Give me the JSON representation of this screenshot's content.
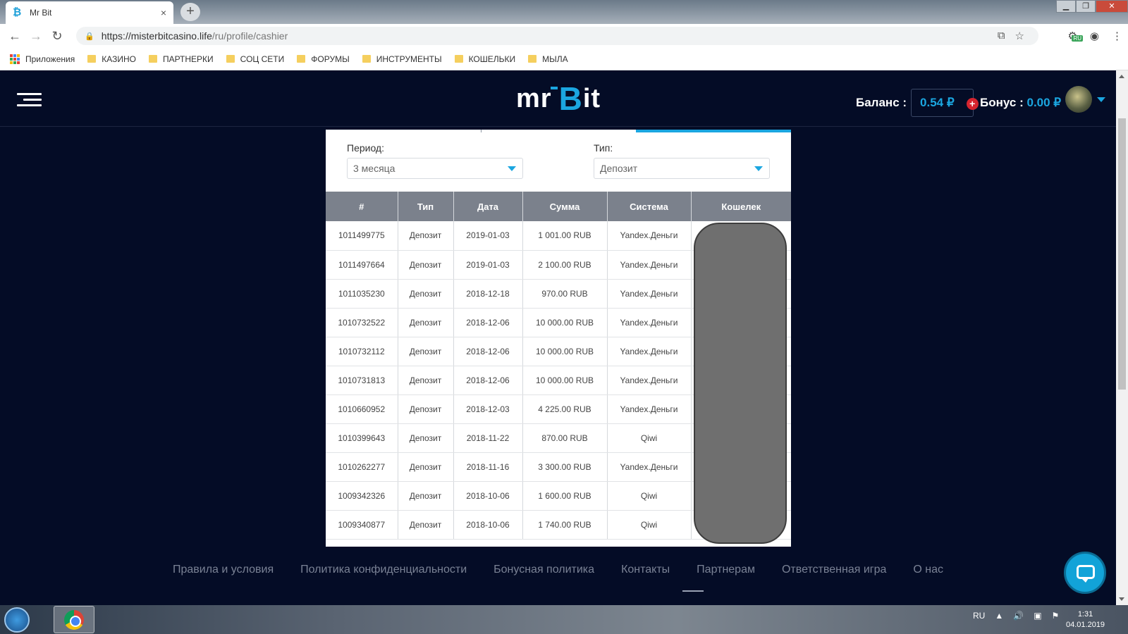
{
  "browser": {
    "tab_title": "Mr Bit",
    "tab_close": "×",
    "new_tab": "+",
    "url_host": "https://misterbitcasino.life",
    "url_path": "/ru/profile/cashier",
    "bookmarks": [
      {
        "label": "Приложения",
        "type": "apps"
      },
      {
        "label": "КАЗИНО"
      },
      {
        "label": "ПАРТНЕРКИ"
      },
      {
        "label": "СОЦ СЕТИ"
      },
      {
        "label": "ФОРУМЫ"
      },
      {
        "label": "ИНСТРУМЕНТЫ"
      },
      {
        "label": "КОШЕЛЬКИ"
      },
      {
        "label": "МЫЛА"
      }
    ],
    "extension_badge": "RU"
  },
  "site": {
    "balance_label": "Баланс :",
    "balance_value": "0.54 ₽",
    "balance_add": "+",
    "bonus_label": "Бонус :",
    "bonus_value": "0.00 ₽",
    "logo_mr": "mr",
    "logo_b": "B",
    "logo_it": "it"
  },
  "filters": {
    "period_label": "Период:",
    "period_value": "3 месяца",
    "type_label": "Тип:",
    "type_value": "Депозит"
  },
  "table": {
    "headers": [
      "#",
      "Тип",
      "Дата",
      "Сумма",
      "Система",
      "Кошелек"
    ],
    "rows": [
      [
        "1011499775",
        "Депозит",
        "2019-01-03",
        "1 001.00 RUB",
        "Yandex.Деньги"
      ],
      [
        "1011497664",
        "Депозит",
        "2019-01-03",
        "2 100.00 RUB",
        "Yandex.Деньги"
      ],
      [
        "1011035230",
        "Депозит",
        "2018-12-18",
        "970.00 RUB",
        "Yandex.Деньги"
      ],
      [
        "1010732522",
        "Депозит",
        "2018-12-06",
        "10 000.00 RUB",
        "Yandex.Деньги"
      ],
      [
        "1010732112",
        "Депозит",
        "2018-12-06",
        "10 000.00 RUB",
        "Yandex.Деньги"
      ],
      [
        "1010731813",
        "Депозит",
        "2018-12-06",
        "10 000.00 RUB",
        "Yandex.Деньги"
      ],
      [
        "1010660952",
        "Депозит",
        "2018-12-03",
        "4 225.00 RUB",
        "Yandex.Деньги"
      ],
      [
        "1010399643",
        "Депозит",
        "2018-11-22",
        "870.00 RUB",
        "Qiwi"
      ],
      [
        "1010262277",
        "Депозит",
        "2018-11-16",
        "3 300.00 RUB",
        "Yandex.Деньги"
      ],
      [
        "1009342326",
        "Депозит",
        "2018-10-06",
        "1 600.00 RUB",
        "Qiwi"
      ],
      [
        "1009340877",
        "Депозит",
        "2018-10-06",
        "1 740.00 RUB",
        "Qiwi"
      ]
    ]
  },
  "footer": {
    "links": [
      "Правила и условия",
      "Политика конфиденциальности",
      "Бонусная политика",
      "Контакты",
      "Партнерам",
      "Ответственная игра",
      "О нас"
    ]
  },
  "taskbar": {
    "lang": "RU",
    "time": "1:31",
    "date": "04.01.2019"
  },
  "colors": {
    "accent": "#1ba6e0",
    "site_bg": "#040c26",
    "table_header": "#7b818c",
    "add_button": "#d6242f"
  }
}
